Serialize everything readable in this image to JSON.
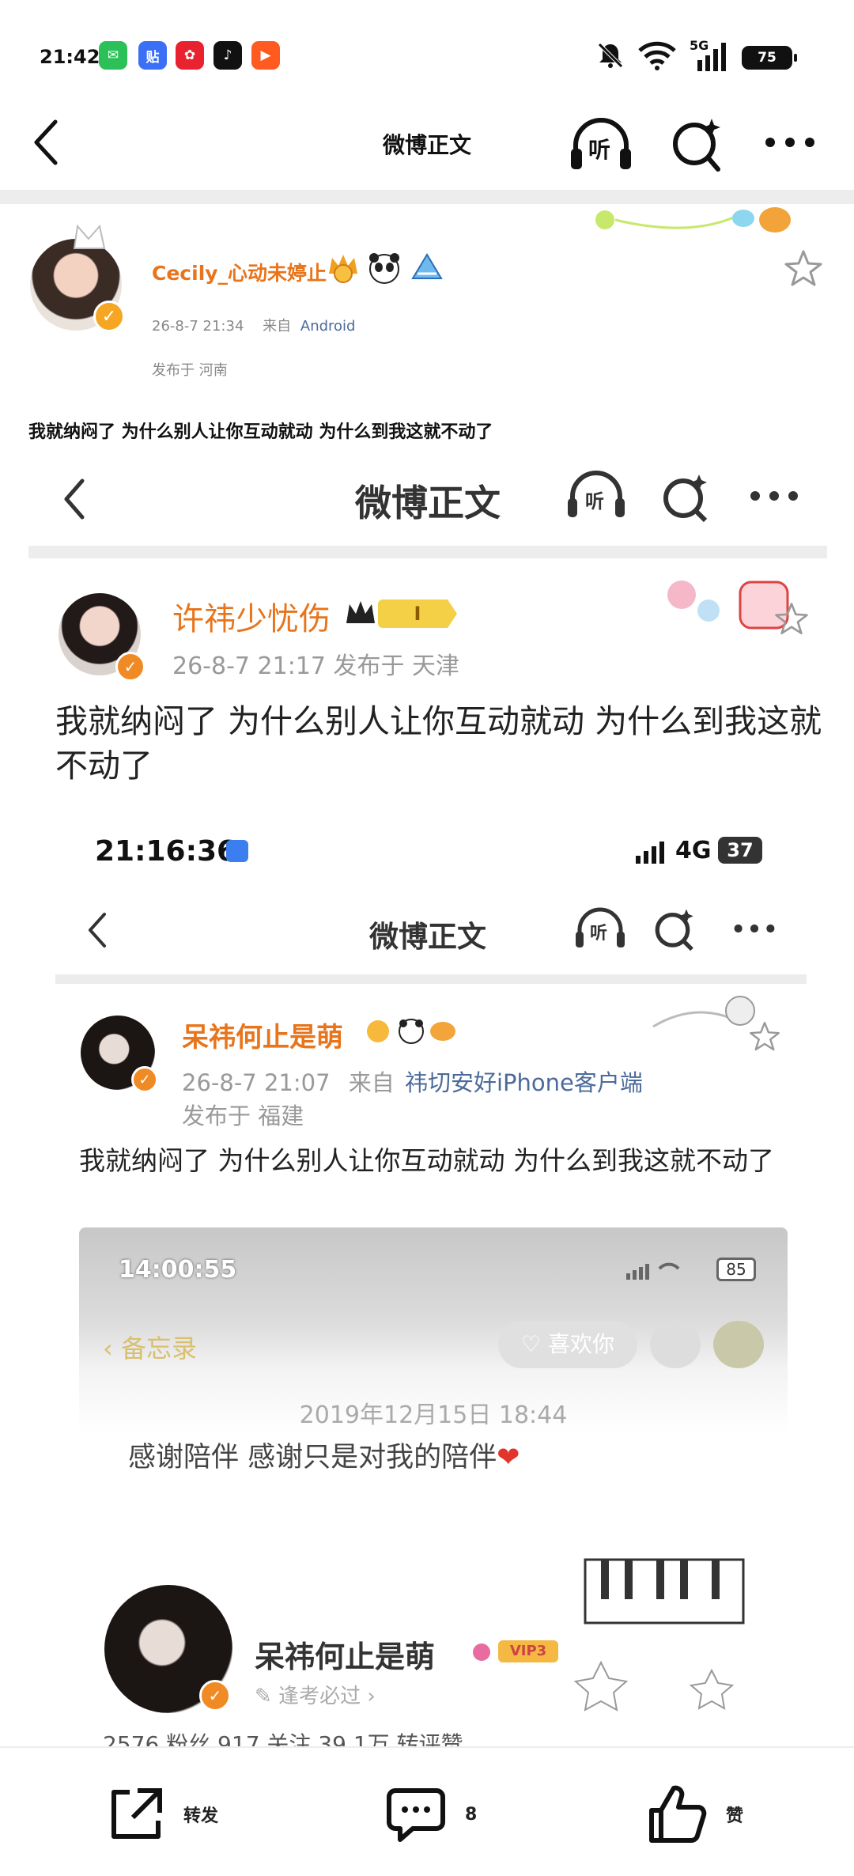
{
  "status_bar": {
    "time": "21:42",
    "battery": "75",
    "network": "5G",
    "apps": [
      {
        "icon": "wechat-icon",
        "glyph": "✉",
        "color": "#2bc158"
      },
      {
        "icon": "tieba-icon",
        "glyph": "贴",
        "color": "#3b6ff5"
      },
      {
        "icon": "huawei-mall-icon",
        "glyph": "✿",
        "color": "#e8232f"
      },
      {
        "icon": "tiktok-icon",
        "glyph": "♪",
        "color": "#111111"
      },
      {
        "icon": "kuaishou-icon",
        "glyph": "▶",
        "color": "#ff5a1f"
      }
    ]
  },
  "nav": {
    "title": "微博正文",
    "listen_label": "听"
  },
  "post": {
    "author": "Cecily_心动未婷止",
    "time": "26-8-7 21:34",
    "source_prefix": "来自",
    "source": "Android",
    "location_label": "发布于 河南",
    "text": "我就纳闷了 为什么别人让你互动就动 为什么到我这就不动了"
  },
  "embed1": {
    "nav_title": "微博正文",
    "listen_label": "听",
    "author": "许祎少忧伤",
    "level": "I",
    "meta": "26-8-7 21:17  发布于 天津",
    "text": "我就纳闷了 为什么别人让你互动就动 为什么到我这就不动了",
    "badge": "✓"
  },
  "embed2_status": {
    "time": "21:16:36",
    "network": "4G",
    "battery": "37"
  },
  "embed2": {
    "nav_title": "微博正文",
    "listen_label": "听",
    "author": "呆祎何止是萌",
    "time": "26-8-7 21:07",
    "source_prefix": "来自",
    "source": "祎切安好iPhone客户端",
    "location": "发布于 福建",
    "text": "我就纳闷了 为什么别人让你互动就动 为什么到我这就不动了"
  },
  "embed3": {
    "status_time": "14:00:55",
    "battery": "85",
    "back_label": "备忘录",
    "like_label": "喜欢你",
    "date": "2019年12月15日 18:44",
    "note": "感谢陪伴 感谢只是对我的陪伴",
    "profile_name": "呆祎何止是萌",
    "vip": "VIP3",
    "profile_sub": "逢考必过",
    "stats_partial": "2576 粉丝   917 关注   39.1万 转评赞"
  },
  "bottom_bar": {
    "repost_label": "转发",
    "comment_count": "8",
    "like_label": "赞"
  }
}
